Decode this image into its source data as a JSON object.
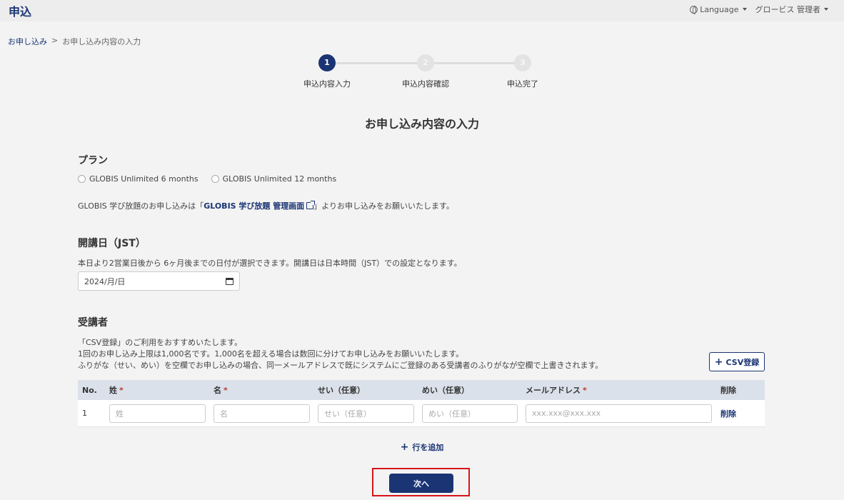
{
  "header": {
    "title": "申込",
    "language_label": "Language",
    "user_label": "グロービス 管理者"
  },
  "breadcrumb": {
    "home": "お申し込み",
    "separator": ">",
    "current": "お申し込み内容の入力"
  },
  "steps": [
    {
      "number": "1",
      "label": "申込内容入力",
      "state": "active"
    },
    {
      "number": "2",
      "label": "申込内容確認",
      "state": "inactive"
    },
    {
      "number": "3",
      "label": "申込完了",
      "state": "inactive"
    }
  ],
  "page_title": "お申し込み内容の入力",
  "plan": {
    "heading": "プラン",
    "options": [
      "GLOBIS Unlimited 6 months",
      "GLOBIS Unlimited 12 months"
    ],
    "note_prefix": "GLOBIS 学び放題のお申し込みは「",
    "note_link": "GLOBIS 学び放題 管理画面",
    "note_suffix": "」よりお申し込みをお願いいたします。"
  },
  "start_date": {
    "heading": "開講日（JST）",
    "description": "本日より2営業日後から 6ヶ月後までの日付が選択できます。開講日は日本時間（JST）での設定となります。",
    "value": "2024/月/日"
  },
  "recipients": {
    "heading": "受講者",
    "desc_lines": [
      "「CSV登録」のご利用をおすすめいたします。",
      "1回のお申し込み上限は1,000名です。1,000名を超える場合は数回に分けてお申し込みをお願いいたします。",
      "ふりがな（せい、めい）を空欄でお申し込みの場合、同一メールアドレスで既にシステムにご登録のある受講者のふりがなが空欄で上書きされます。"
    ],
    "csv_button": "CSV登録",
    "columns": {
      "no": "No.",
      "last_name": "姓",
      "first_name": "名",
      "last_kana": "せい（任意）",
      "first_kana": "めい（任意）",
      "email": "メールアドレス",
      "delete": "削除",
      "required_mark": "*"
    },
    "rows": [
      {
        "no": "1",
        "last_name_ph": "姓",
        "first_name_ph": "名",
        "last_kana_ph": "せい（任意）",
        "first_kana_ph": "めい（任意）",
        "email_ph": "xxx.xxx@xxx.xxx",
        "delete": "削除"
      }
    ],
    "add_row": "行を追加"
  },
  "next_button": "次へ",
  "colors": {
    "primary": "#1a3474",
    "highlight": "#d8141a",
    "header_row": "#dbe1ea"
  }
}
